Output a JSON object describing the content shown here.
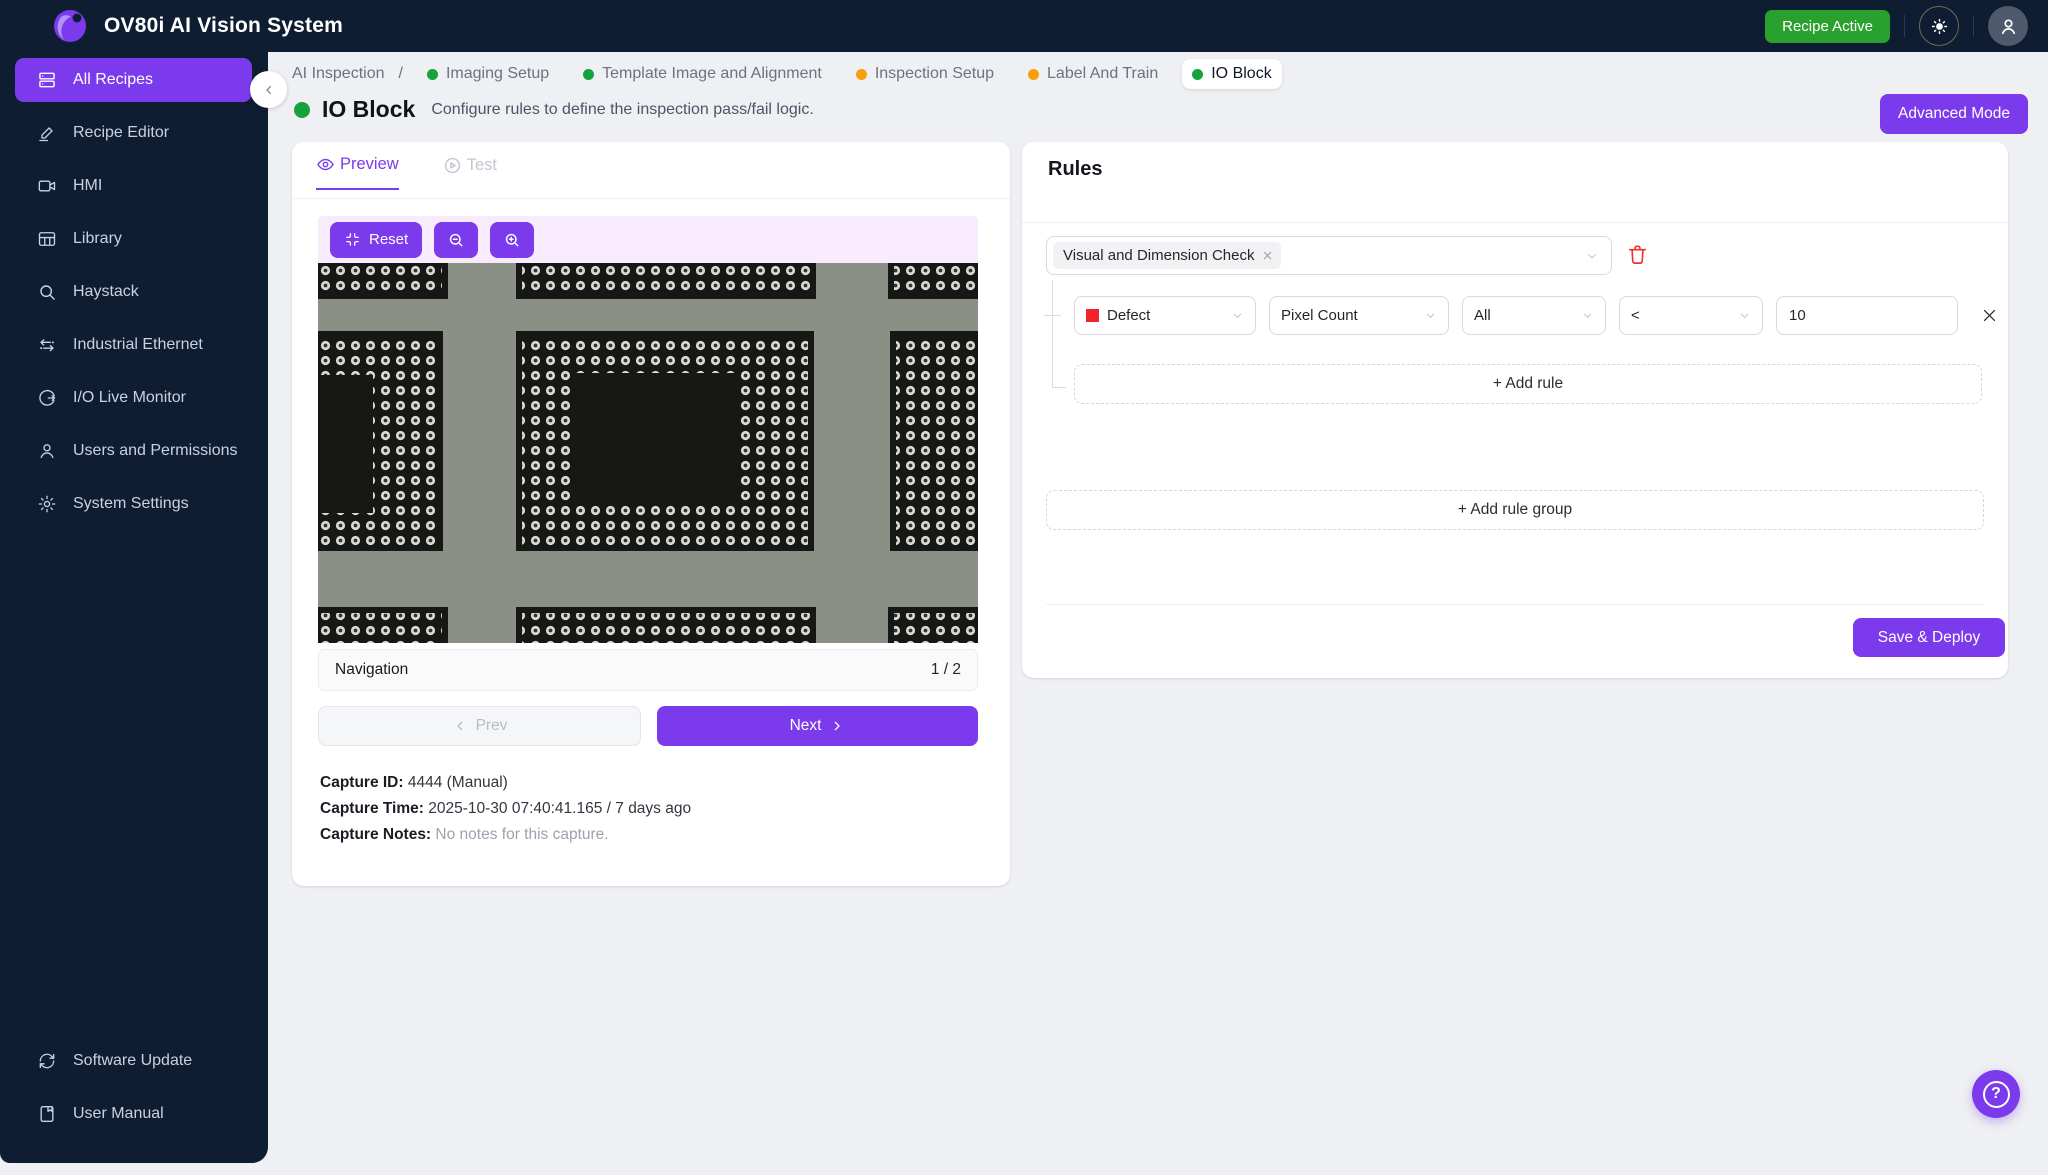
{
  "topbar": {
    "title": "OV80i AI Vision System",
    "recipe_status": "Recipe Active"
  },
  "sidebar": {
    "items": [
      {
        "label": "All Recipes",
        "icon": "recipes-icon",
        "active": true
      },
      {
        "label": "Recipe Editor",
        "icon": "pencil-icon",
        "active": false
      },
      {
        "label": "HMI",
        "icon": "video-icon",
        "active": false
      },
      {
        "label": "Library",
        "icon": "table-icon",
        "active": false
      },
      {
        "label": "Haystack",
        "icon": "search-icon",
        "active": false
      },
      {
        "label": "Industrial Ethernet",
        "icon": "arrows-icon",
        "active": false
      },
      {
        "label": "I/O Live Monitor",
        "icon": "monitor-loop-icon",
        "active": false
      },
      {
        "label": "Users and Permissions",
        "icon": "user-icon",
        "active": false
      },
      {
        "label": "System Settings",
        "icon": "gear-icon",
        "active": false
      }
    ],
    "footer_items": [
      {
        "label": "Software Update",
        "icon": "refresh-icon"
      },
      {
        "label": "User Manual",
        "icon": "manual-icon"
      }
    ]
  },
  "breadcrumb": {
    "root": "AI Inspection",
    "separator": "/",
    "steps": [
      {
        "label": "Imaging Setup",
        "status": "green"
      },
      {
        "label": "Template Image and Alignment",
        "status": "green"
      },
      {
        "label": "Inspection Setup",
        "status": "orange"
      },
      {
        "label": "Label And Train",
        "status": "orange"
      },
      {
        "label": "IO Block",
        "status": "green",
        "active": true
      }
    ]
  },
  "page": {
    "title": "IO Block",
    "subtitle": "Configure rules to define the inspection pass/fail logic.",
    "advanced_mode_label": "Advanced Mode"
  },
  "preview_panel": {
    "tabs": [
      {
        "label": "Preview",
        "active": true
      },
      {
        "label": "Test",
        "active": false
      }
    ],
    "toolbar": {
      "reset_label": "Reset"
    },
    "navigation": {
      "label": "Navigation",
      "page_indicator": "1 / 2",
      "prev_label": "Prev",
      "next_label": "Next"
    },
    "capture": {
      "id_label": "Capture ID:",
      "id_value": "4444 (Manual)",
      "time_label": "Capture Time:",
      "time_value": "2025-10-30 07:40:41.165 / 7 days ago",
      "notes_label": "Capture Notes:",
      "notes_value": "No notes for this capture."
    }
  },
  "rules_panel": {
    "title": "Rules",
    "group_select": {
      "tag": "Visual and Dimension Check"
    },
    "rule": {
      "class_value": "Defect",
      "class_color": "#f5222d",
      "feature_value": "Pixel Count",
      "scope_value": "All",
      "operator_value": "<",
      "threshold_value": "10"
    },
    "add_rule_label": "+ Add rule",
    "add_rule_group_label": "+ Add rule group",
    "save_label": "Save & Deploy"
  },
  "help": {
    "glyph": "?"
  },
  "colors": {
    "accent": "#7c3aed",
    "sidebar_bg": "#0f1d33",
    "recipe_active_green": "#2aa12e",
    "step_done_green": "#17a33c",
    "step_pending_orange": "#f59f0a",
    "defect_red": "#f5222d",
    "toolbar_pink": "#f8ebfd"
  }
}
